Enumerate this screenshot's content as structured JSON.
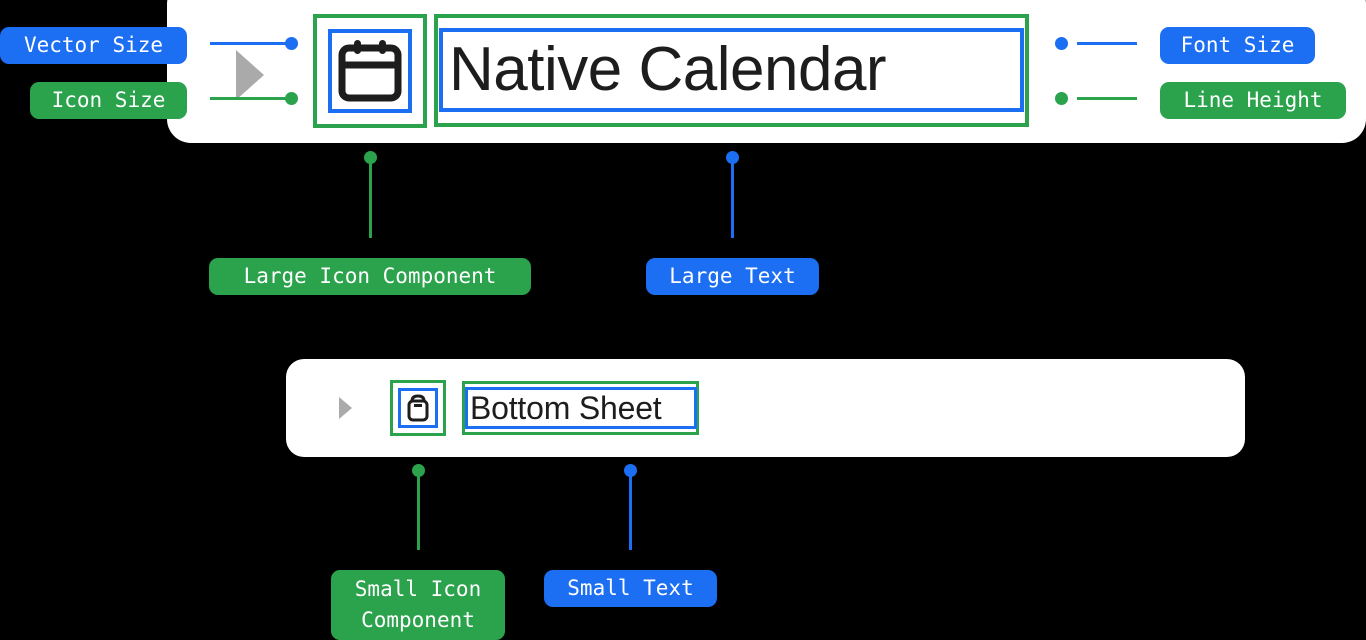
{
  "diagram": {
    "title": "Component Sizing Annotation Diagram"
  },
  "top_card": {
    "expander_icon": "play-triangle-icon",
    "icon_name": "calendar-icon",
    "text": "Native Calendar"
  },
  "bottom_card": {
    "expander_icon": "play-triangle-icon",
    "icon_name": "bottom-sheet-icon",
    "text": "Bottom Sheet"
  },
  "badges": {
    "vector_size": "Vector Size",
    "icon_size": "Icon Size",
    "font_size": "Font Size",
    "line_height": "Line Height",
    "large_icon_component": "Large Icon Component",
    "large_text": "Large Text",
    "small_icon_component": "Small Icon\nComponent",
    "small_text": "Small Text"
  },
  "colors": {
    "blue": "#1c6ef2",
    "green": "#2ba24c",
    "card_background": "#ffffff",
    "page_background": "#000000",
    "triangle_gray": "#aaaaaa",
    "text": "#1d1d1d"
  },
  "measurement_boxes": {
    "outer_border_meaning": "Icon Size / Line Height",
    "outer_border_color": "#2ba24c",
    "inner_border_meaning": "Vector Size / Font Size",
    "inner_border_color": "#1c6ef2"
  }
}
